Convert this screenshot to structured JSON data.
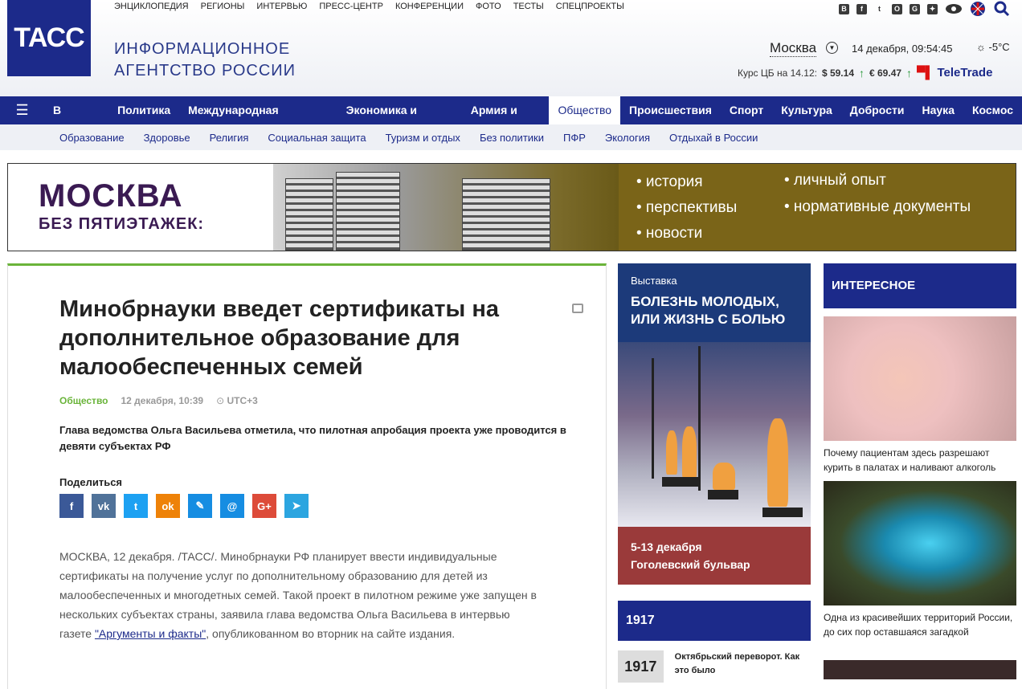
{
  "brand": {
    "logo": "ТАСС",
    "agency_line1": "ИНФОРМАЦИОННОЕ",
    "agency_line2": "АГЕНТСТВО РОССИИ"
  },
  "toplinks": [
    "ЭНЦИКЛОПЕДИЯ",
    "РЕГИОНЫ",
    "ИНТЕРВЬЮ",
    "ПРЕСС-ЦЕНТР",
    "КОНФЕРЕНЦИИ",
    "ФОТО",
    "ТЕСТЫ",
    "СПЕЦПРОЕКТЫ"
  ],
  "social": [
    "В",
    "f",
    "t",
    "O",
    "G",
    "✦"
  ],
  "city": "Москва",
  "datetime": "14 декабря, 09:54:45",
  "weather": "-5°C",
  "rates": {
    "label": "Курс ЦБ на 14.12:",
    "usd": "$ 59.14",
    "eur": "€ 69.47",
    "partner": "TeleTrade"
  },
  "mainnav": [
    "В стране",
    "Политика",
    "Международная панорама",
    "Экономика и бизнес",
    "Армия и ОПК",
    "Общество",
    "Происшествия",
    "Спорт",
    "Культура",
    "Доброcти",
    "Наука",
    "Космос"
  ],
  "subnav": [
    "Образование",
    "Здоровье",
    "Религия",
    "Социальная защита",
    "Туризм и отдых",
    "Без политики",
    "ПФР",
    "Экология",
    "Отдыхай в России"
  ],
  "banner": {
    "title": "МОСКВА",
    "subtitle": "БЕЗ ПЯТИЭТАЖЕК:",
    "items": [
      "• история",
      "• личный опыт",
      "• перспективы",
      "• нормативные документы",
      "• новости"
    ]
  },
  "article": {
    "title": "Минобрнауки введет сертификаты на дополнительное образование для малообеспеченных семей",
    "category": "Общество",
    "date": "12 декабря, 10:39",
    "tz": "UTC+3",
    "lead": "Глава ведомства Ольга Васильева отметила, что пилотная апробация проекта уже проводится в девяти субъектах РФ",
    "share_label": "Поделиться",
    "body_before": "МОСКВА, 12 декабря. /ТАСС/. Минобрнауки РФ планирует ввести индивидуальные сертификаты на получение услуг по дополнительному образованию для детей из малообеспеченных и многодетных семей. Такой проект в пилотном режиме уже запущен в нескольких субъектах страны, заявила глава ведомства Ольга Васильева в интервью газете ",
    "body_link": "\"Аргументы и факты\"",
    "body_after": ", опубликованном во вторник на сайте издания."
  },
  "exhibit": {
    "kicker": "Выставка",
    "title": "БОЛЕЗНЬ МОЛОДЫХ, ИЛИ ЖИЗНЬ С БОЛЬЮ",
    "dates": "5-13 декабря",
    "place": "Гоголевский бульвар"
  },
  "block1917": {
    "header": "1917",
    "thumb": "1917",
    "text": "Октябрьский переворот. Как это было"
  },
  "interesting": {
    "header": "ИНТЕРЕСНОЕ",
    "items": [
      {
        "caption": "Почему пациентам здесь разрешают курить в палатах и наливают алкоголь"
      },
      {
        "caption": "Одна из красивейших территорий России, до сих пор оставшаяся загадкой"
      }
    ]
  }
}
